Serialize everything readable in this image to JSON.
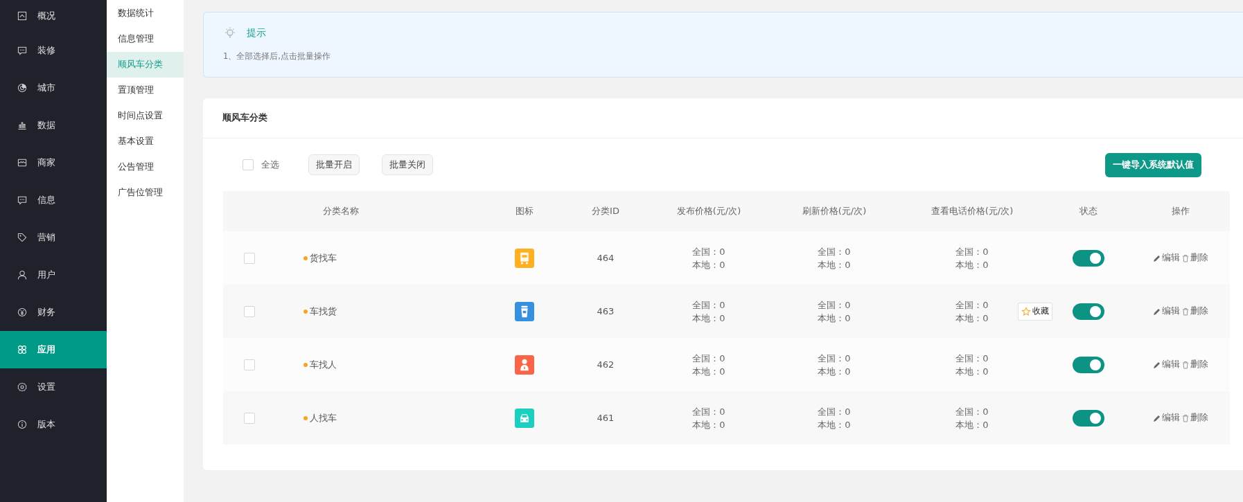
{
  "sidebar": {
    "items": [
      {
        "label": "概况",
        "selected": false
      },
      {
        "label": "装修",
        "selected": false
      },
      {
        "label": "城市",
        "selected": false
      },
      {
        "label": "数据",
        "selected": false
      },
      {
        "label": "商家",
        "selected": false
      },
      {
        "label": "信息",
        "selected": false
      },
      {
        "label": "营销",
        "selected": false
      },
      {
        "label": "用户",
        "selected": false
      },
      {
        "label": "财务",
        "selected": false
      },
      {
        "label": "应用",
        "selected": true
      },
      {
        "label": "设置",
        "selected": false
      },
      {
        "label": "版本",
        "selected": false
      }
    ]
  },
  "submenu": {
    "items": [
      {
        "label": "数据统计",
        "selected": false
      },
      {
        "label": "信息管理",
        "selected": false
      },
      {
        "label": "顺风车分类",
        "selected": true
      },
      {
        "label": "置顶管理",
        "selected": false
      },
      {
        "label": "时间点设置",
        "selected": false
      },
      {
        "label": "基本设置",
        "selected": false
      },
      {
        "label": "公告管理",
        "selected": false
      },
      {
        "label": "广告位管理",
        "selected": false
      }
    ]
  },
  "tip": {
    "title": "提示",
    "lines": [
      "1、全部选择后,点击批量操作"
    ]
  },
  "panel": {
    "title": "顺风车分类",
    "select_all": {
      "label": "全选",
      "checked": false
    },
    "buttons": [
      "批量开启",
      "批量关闭"
    ],
    "import_button": "一键导入系统默认值"
  },
  "table": {
    "columns": [
      "分类名称",
      "图标",
      "分类ID",
      "发布价格(元/次)",
      "刷新价格(元/次)",
      "查看电话价格(元/次)",
      "状态",
      "操作"
    ],
    "rows": [
      {
        "checked": false,
        "name": "货找车",
        "icon": {
          "kind": "cargo",
          "color": "#ffb020"
        },
        "id": "464",
        "publish": [
          "全国：0",
          "本地：0"
        ],
        "refresh": [
          "全国：0",
          "本地：0"
        ],
        "phone": [
          "全国：0",
          "本地：0"
        ],
        "on": true,
        "actions": [
          "编辑",
          "删除"
        ]
      },
      {
        "checked": false,
        "name": "车找货",
        "icon": {
          "kind": "cup",
          "color": "#3591e0"
        },
        "id": "463",
        "publish": [
          "全国：0",
          "本地：0"
        ],
        "refresh": [
          "全国：0",
          "本地：0"
        ],
        "phone": [
          "全国：0",
          "本地：0"
        ],
        "on": true,
        "actions": [
          "编辑",
          "删除"
        ]
      },
      {
        "checked": false,
        "name": "车找人",
        "icon": {
          "kind": "person",
          "color": "#fa6448"
        },
        "id": "462",
        "publish": [
          "全国：0",
          "本地：0"
        ],
        "refresh": [
          "全国：0",
          "本地：0"
        ],
        "phone": [
          "全国：0",
          "本地：0"
        ],
        "on": true,
        "actions": [
          "编辑",
          "删除"
        ]
      },
      {
        "checked": false,
        "name": "人找车",
        "icon": {
          "kind": "car",
          "color": "#1ccfc0"
        },
        "id": "461",
        "publish": [
          "全国：0",
          "本地：0"
        ],
        "refresh": [
          "全国：0",
          "本地：0"
        ],
        "phone": [
          "全国：0",
          "本地：0"
        ],
        "on": true,
        "actions": [
          "编辑",
          "删除"
        ]
      }
    ]
  },
  "float_button": {
    "label": "收藏"
  }
}
